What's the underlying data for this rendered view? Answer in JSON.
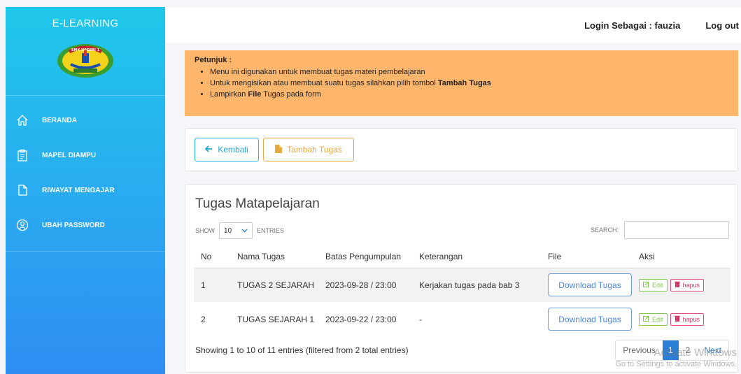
{
  "sidebar": {
    "brand": "E-LEARNING",
    "logo_text": "SMK NEGERI 1",
    "items": [
      {
        "label": "BERANDA",
        "icon": "home-icon"
      },
      {
        "label": "MAPEL DIAMPU",
        "icon": "clipboard-icon"
      },
      {
        "label": "RIWAYAT MENGAJAR",
        "icon": "file-icon"
      },
      {
        "label": "UBAH PASSWORD",
        "icon": "user-circle-icon"
      }
    ]
  },
  "header": {
    "login_text": "Login Sebagai : fauzia",
    "logout_label": "Log out"
  },
  "instructions": {
    "title": "Petunjuk :",
    "item1": "Menu ini digunakan untuk membuat tugas materi pembelajaran",
    "item2_prefix": "Untuk mengisikan atau membuat suatu tugas silahkan pilih tombol ",
    "item2_bold": "Tambah Tugas",
    "item3_prefix": "Lampirkan ",
    "item3_bold": "File",
    "item3_suffix": " Tugas pada form"
  },
  "actions": {
    "back_label": "Kembali",
    "add_label": "Tambah Tugas"
  },
  "table_card": {
    "title": "Tugas Matapelajaran",
    "show_label": "SHOW",
    "entries_value": "10",
    "entries_label": "ENTRIES",
    "search_label": "SEARCH:",
    "search_value": "",
    "columns": [
      "No",
      "Nama Tugas",
      "Batas Pengumpulan",
      "Keterangan",
      "File",
      "Aksi"
    ],
    "rows": [
      {
        "no": "1",
        "nama": "TUGAS 2 SEJARAH",
        "batas": "2023-09-28 / 23:00",
        "keterangan": "Kerjakan tugas pada bab 3",
        "file": "Download Tugas",
        "edit": "Edit",
        "hapus": "hapus"
      },
      {
        "no": "2",
        "nama": "TUGAS SEJARAH 1",
        "batas": "2023-09-22 / 23:00",
        "keterangan": "-",
        "file": "Download Tugas",
        "edit": "Edit",
        "hapus": "hapus"
      }
    ],
    "info": "Showing 1 to 10 of 11 entries (filtered from 2 total entries)",
    "pagination": {
      "previous": "Previous",
      "pages": [
        "1",
        "2"
      ],
      "next": "Next"
    }
  },
  "watermark": {
    "line1": "Activate Windows",
    "line2": "Go to Settings to activate Windows."
  },
  "colors": {
    "sidebar_top": "#1fc8ea",
    "sidebar_bottom": "#2f8df2",
    "instruction_bg": "#fdb66c",
    "accent_blue": "#2b7fd6",
    "edit_green": "#7dc94a",
    "delete_pink": "#e0507a"
  }
}
